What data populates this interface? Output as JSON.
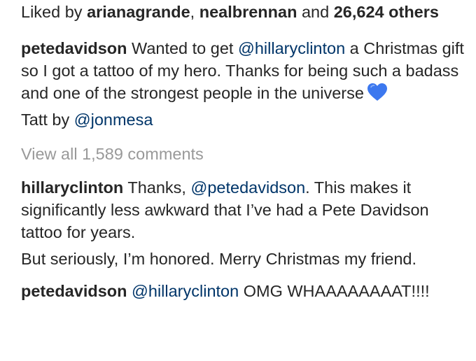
{
  "likes": {
    "prefix": "Liked by ",
    "user1": "arianagrande",
    "sep": ", ",
    "user2": "nealbrennan",
    "and": " and ",
    "others": "26,624 others"
  },
  "caption": {
    "username": "petedavidson",
    "text_before_mention": " Wanted to get ",
    "mention": "@hillaryclinton",
    "text_after_mention": " a Christmas gift so I got a tattoo of my hero. Thanks for being such a badass and one of the strongest people in the universe",
    "emoji": "blue-heart-icon",
    "credit_prefix": "Tatt by ",
    "credit_mention": "@jonmesa"
  },
  "view_all_comments": "View all 1,589 comments",
  "comments": [
    {
      "username": "hillaryclinton",
      "text_before_mention": " Thanks, ",
      "mention": "@petedavidson",
      "text_after_mention": ". This makes it significantly less awkward that I’ve had a Pete Davidson tattoo for years.",
      "second_line": "But seriously, I’m honored. Merry Christmas my friend."
    },
    {
      "username": "petedavidson",
      "mention": "@hillaryclinton",
      "text_after_mention": " OMG WHAAAAAAAAT!!!!"
    }
  ],
  "colors": {
    "text": "#262626",
    "mention": "#003569",
    "muted": "#999999",
    "heart": "#3c78ef"
  }
}
